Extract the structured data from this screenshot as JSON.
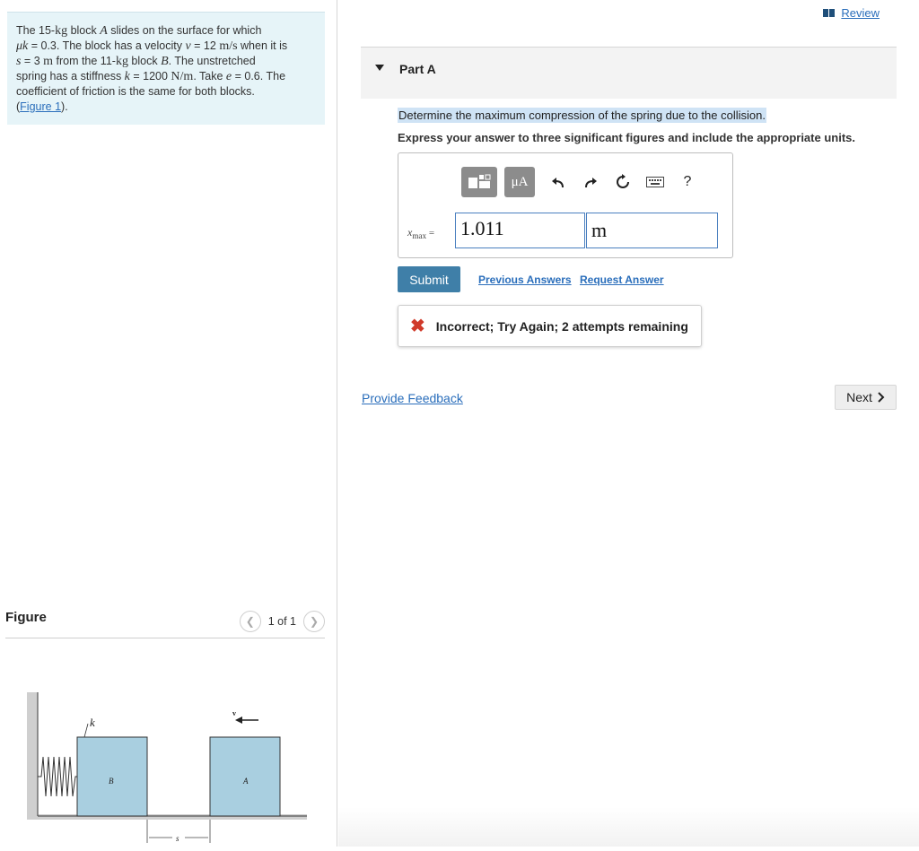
{
  "problem": {
    "line1_pre": "The 15-",
    "line1_kg": "kg",
    "line1_mid": " block ",
    "line1_A": "A",
    "line1_post": " slides on the surface for which",
    "line2_mu": "μk",
    "line2_a": " = 0.3. The block has a velocity ",
    "line2_v": "v",
    "line2_b": " = 12 ",
    "line2_unit": "m/s",
    "line2_c": " when it is",
    "line3_s": "s",
    "line3_a": " = 3 ",
    "line3_m": "m",
    "line3_b": " from the 11-",
    "line3_kg": "kg",
    "line3_c": " block ",
    "line3_B": "B",
    "line3_d": ". The unstretched",
    "line4_a": "spring has a stiffness ",
    "line4_k": "k",
    "line4_b": " = 1200 ",
    "line4_unit": "N/m",
    "line4_c": ". Take ",
    "line4_e": "e",
    "line4_d": " = 0.6. The",
    "line5": "coefficient of friction is the same for both blocks.",
    "figure_link": "Figure 1",
    "figure_link_open": "(",
    "figure_link_close": ")."
  },
  "figure_panel": {
    "title": "Figure",
    "pager_text": "1 of 1",
    "labels": {
      "k": "k",
      "B": "B",
      "A": "A",
      "v": "v",
      "s": "s"
    }
  },
  "header": {
    "review_label": "Review"
  },
  "part": {
    "label": "Part A"
  },
  "question": {
    "prompt": "Determine the maximum compression of the spring due to the collision.",
    "instruction": "Express your answer to three significant figures and include the appropriate units."
  },
  "answer": {
    "var_label": "x",
    "var_sub": "max",
    "equals": "=",
    "value": "1.011",
    "unit": "m",
    "toolbar": {
      "mu_label": "μA",
      "help_label": "?",
      "icons": [
        "templates-icon",
        "units-icon",
        "undo-icon",
        "redo-icon",
        "reset-icon",
        "keyboard-icon",
        "help-icon"
      ]
    }
  },
  "actions": {
    "submit_label": "Submit",
    "previous_answers_label": "Previous Answers",
    "request_answer_label": "Request Answer"
  },
  "feedback": {
    "message": "Incorrect; Try Again; 2 attempts remaining",
    "status_color": "#d03a2a"
  },
  "footer": {
    "provide_feedback_label": "Provide Feedback",
    "next_label": "Next"
  },
  "colors": {
    "problem_bg": "#e6f4f8",
    "link": "#2a6ebb",
    "submit_bg": "#3f7fa8",
    "block_fill": "#a9cfe0"
  }
}
